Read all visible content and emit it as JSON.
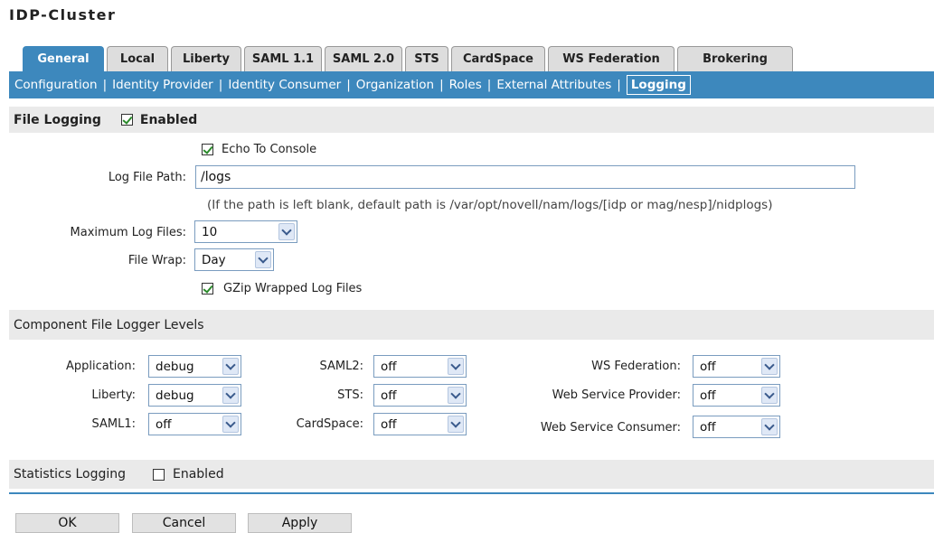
{
  "page_title": "IDP-Cluster",
  "tabs": [
    {
      "label": "General"
    },
    {
      "label": "Local"
    },
    {
      "label": "Liberty"
    },
    {
      "label": "SAML 1.1"
    },
    {
      "label": "SAML 2.0"
    },
    {
      "label": "STS"
    },
    {
      "label": "CardSpace"
    },
    {
      "label": "WS Federation"
    },
    {
      "label": "Brokering"
    }
  ],
  "subnav": [
    {
      "label": "Configuration"
    },
    {
      "label": "Identity Provider"
    },
    {
      "label": "Identity Consumer"
    },
    {
      "label": "Organization"
    },
    {
      "label": "Roles"
    },
    {
      "label": "External Attributes"
    },
    {
      "label": "Logging"
    }
  ],
  "file_logging": {
    "header": "File Logging",
    "enabled_label": "Enabled",
    "enabled": true,
    "echo_label": "Echo To Console",
    "echo": true,
    "log_path_label": "Log File Path:",
    "log_path_value": "/logs",
    "path_hint": "(If the path is left blank, default path is /var/opt/novell/nam/logs/[idp or mag/nesp]/nidplogs)",
    "max_files_label": "Maximum Log Files:",
    "max_files_value": "10",
    "wrap_label": "File Wrap:",
    "wrap_value": "Day",
    "gzip_label": "GZip Wrapped Log Files",
    "gzip": true
  },
  "component_levels": {
    "header": "Component File Logger Levels",
    "col1": [
      {
        "label": "Application:",
        "value": "debug"
      },
      {
        "label": "Liberty:",
        "value": "debug"
      },
      {
        "label": "SAML1:",
        "value": "off"
      }
    ],
    "col2": [
      {
        "label": "SAML2:",
        "value": "off"
      },
      {
        "label": "STS:",
        "value": "off"
      },
      {
        "label": "CardSpace:",
        "value": "off"
      }
    ],
    "col3": [
      {
        "label": "WS Federation:",
        "value": "off"
      },
      {
        "label": "Web Service Provider:",
        "value": "off"
      },
      {
        "label": "Web Service Consumer:",
        "value": "off"
      }
    ]
  },
  "statistics_logging": {
    "header": "Statistics Logging",
    "enabled_label": "Enabled",
    "enabled": false
  },
  "buttons": {
    "ok": "OK",
    "cancel": "Cancel",
    "apply": "Apply"
  },
  "colors": {
    "accent": "#3d88bd",
    "tab_inactive": "#dddddd",
    "section_bg": "#eaeaea",
    "check": "#2a8a2a"
  }
}
